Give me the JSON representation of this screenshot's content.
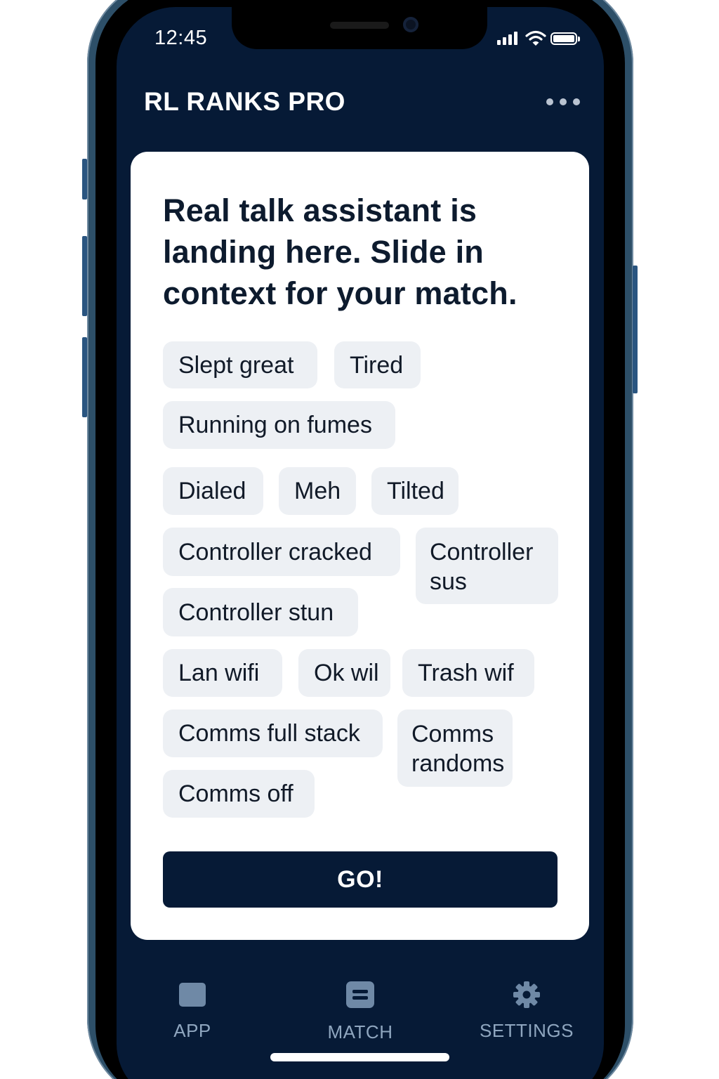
{
  "status_bar": {
    "time": "12:45"
  },
  "header": {
    "title": "RL RANKS PRO"
  },
  "card": {
    "prompt": "Real talk assistant is landing here. Slide in context for your match.",
    "chips": {
      "slept_great": "Slept great",
      "tired": "Tired",
      "running_on_fumes": "Running on fumes",
      "dialed": "Dialed",
      "meh": "Meh",
      "tilted": "Tilted",
      "controller_cracked": "Controller cracked",
      "controller_sus": "Controller sus",
      "controller_stun": "Controller stun",
      "lan_wifi": "Lan wifi",
      "ok_wil": "Ok wil",
      "trash_wif": "Trash wif",
      "comms_full_stack": "Comms full stack",
      "comms_randoms": "Comms randoms",
      "comms_off": "Comms off"
    },
    "go_label": "GO!"
  },
  "tab_bar": {
    "tabs": [
      {
        "label": "APP",
        "icon": "app-icon"
      },
      {
        "label": "MATCH",
        "icon": "match-icon"
      },
      {
        "label": "SETTINGS",
        "icon": "gear-icon"
      }
    ]
  },
  "colors": {
    "background": "#061a36",
    "card": "#ffffff",
    "chip": "#edf0f4",
    "tab_inactive": "#8fa6bf"
  }
}
